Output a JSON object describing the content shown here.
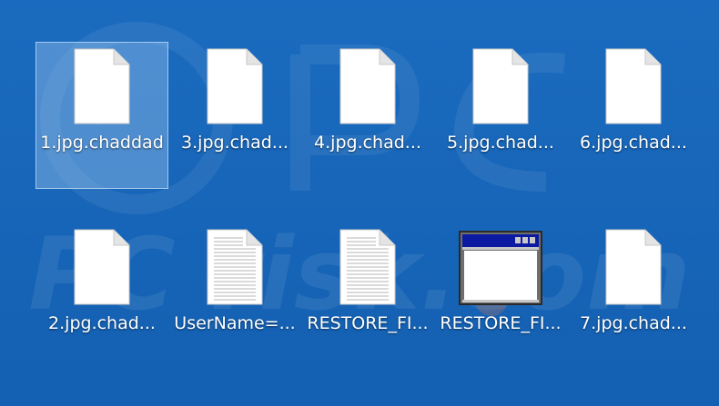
{
  "desktop": {
    "icons": [
      {
        "label": "1.jpg.chaddad",
        "type": "blank"
      },
      {
        "label": "3.jpg.chad...",
        "type": "blank"
      },
      {
        "label": "4.jpg.chad...",
        "type": "blank"
      },
      {
        "label": "5.jpg.chad...",
        "type": "blank"
      },
      {
        "label": "6.jpg.chad...",
        "type": "blank"
      },
      {
        "label": "2.jpg.chad...",
        "type": "blank"
      },
      {
        "label": "UserName=...",
        "type": "text"
      },
      {
        "label": "RESTORE_FI...",
        "type": "text"
      },
      {
        "label": "RESTORE_FI...",
        "type": "window"
      },
      {
        "label": "7.jpg.chad...",
        "type": "blank"
      }
    ],
    "selected_index": 0,
    "watermark_text": "PC risk.com"
  },
  "colors": {
    "background": "#1565b8",
    "selection": "#9bc3eb",
    "label_text": "#ffffff"
  }
}
